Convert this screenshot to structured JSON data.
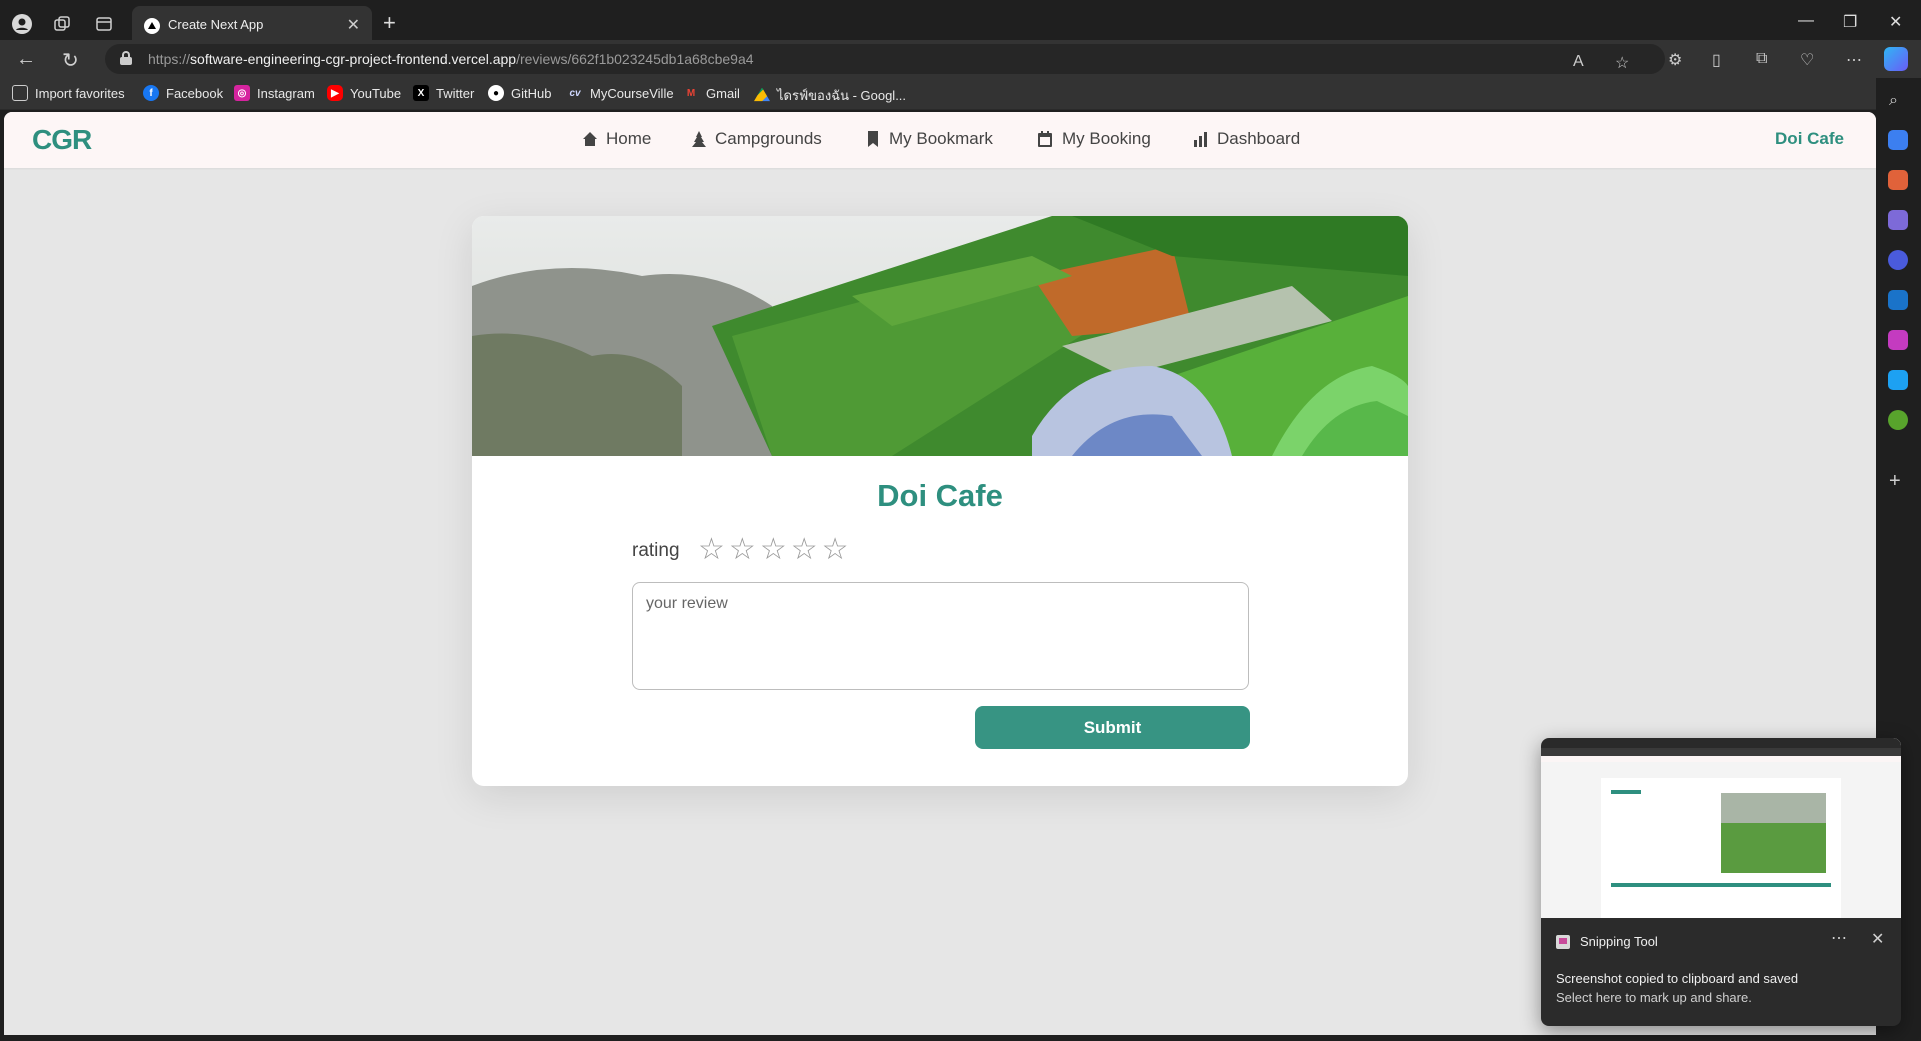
{
  "browser": {
    "tab_title": "Create Next App",
    "url_scheme": "https://",
    "url_host": "software-engineering-cgr-project-frontend.vercel.app",
    "url_path": "/reviews/662f1b023245db1a68cbe9a4"
  },
  "bookmarks": [
    {
      "label": "Import favorites",
      "icon": "import-icon"
    },
    {
      "label": "Facebook",
      "icon": "facebook-icon",
      "color": "#1877f2"
    },
    {
      "label": "Instagram",
      "icon": "instagram-icon",
      "color": "#d6249f"
    },
    {
      "label": "YouTube",
      "icon": "youtube-icon",
      "color": "#ff0000"
    },
    {
      "label": "Twitter",
      "icon": "x-icon",
      "color": "#000000"
    },
    {
      "label": "GitHub",
      "icon": "github-icon",
      "color": "#ffffff"
    },
    {
      "label": "MyCourseVille",
      "icon": "mycourseville-icon"
    },
    {
      "label": "Gmail",
      "icon": "gmail-icon",
      "color": "#ea4335"
    },
    {
      "label": "ไดรฟ์ของฉัน - Googl...",
      "icon": "google-drive-icon"
    }
  ],
  "site": {
    "logo": "CGR",
    "nav": [
      {
        "label": "Home",
        "icon": "home-icon"
      },
      {
        "label": "Campgrounds",
        "icon": "tent-icon"
      },
      {
        "label": "My Bookmark",
        "icon": "bookmark-icon"
      },
      {
        "label": "My Booking",
        "icon": "calendar-icon"
      },
      {
        "label": "Dashboard",
        "icon": "bar-chart-icon"
      }
    ],
    "user_name": "Doi Cafe",
    "accent_color": "#2e8f7f"
  },
  "review": {
    "title": "Doi Cafe",
    "rating_label": "rating",
    "rating_value": 0,
    "rating_max": 5,
    "placeholder": "your review",
    "submit_label": "Submit"
  },
  "toast": {
    "app_name": "Snipping Tool",
    "line1": "Screenshot copied to clipboard and saved",
    "line2": "Select here to mark up and share."
  }
}
